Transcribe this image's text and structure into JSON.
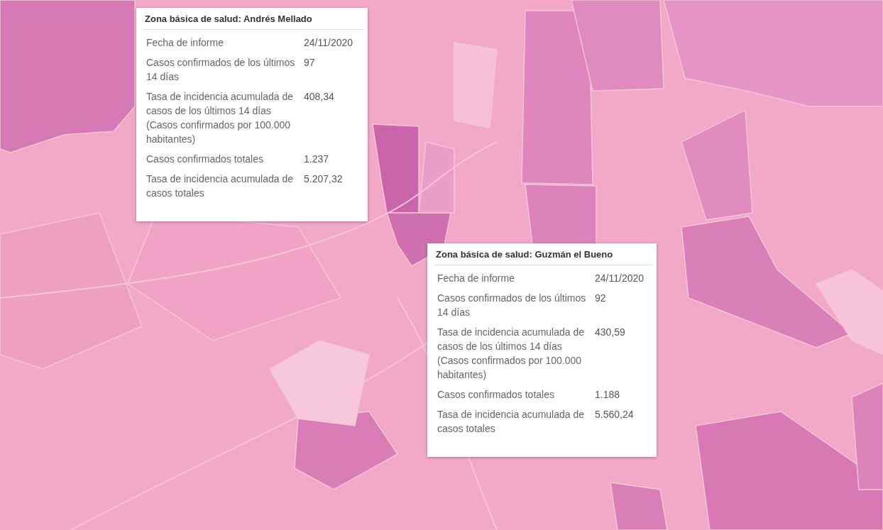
{
  "popups": [
    {
      "title": "Zona básica de salud: Andrés Mellado",
      "rows": [
        {
          "label": "Fecha de informe",
          "value": "24/11/2020"
        },
        {
          "label": "Casos confirmados de los últimos 14 días",
          "value": "97"
        },
        {
          "label": "Tasa de incidencia acumulada de casos de los últimos 14 días (Casos confirmados por 100.000 habitantes)",
          "value": "408,34"
        },
        {
          "label": "Casos confirmados totales",
          "value": "1.237"
        },
        {
          "label": "Tasa de incidencia acumulada de casos totales",
          "value": "5.207,32"
        }
      ]
    },
    {
      "title": "Zona básica de salud: Guzmán el Bueno",
      "rows": [
        {
          "label": "Fecha de informe",
          "value": "24/11/2020"
        },
        {
          "label": "Casos confirmados de los últimos 14 días",
          "value": "92"
        },
        {
          "label": "Tasa de incidencia acumulada de casos de los últimos 14 días (Casos confirmados por 100.000 habitantes)",
          "value": "430,59"
        },
        {
          "label": "Casos confirmados totales",
          "value": "1.188"
        },
        {
          "label": "Tasa de incidencia acumulada de casos totales",
          "value": "5.560,24"
        }
      ]
    }
  ]
}
